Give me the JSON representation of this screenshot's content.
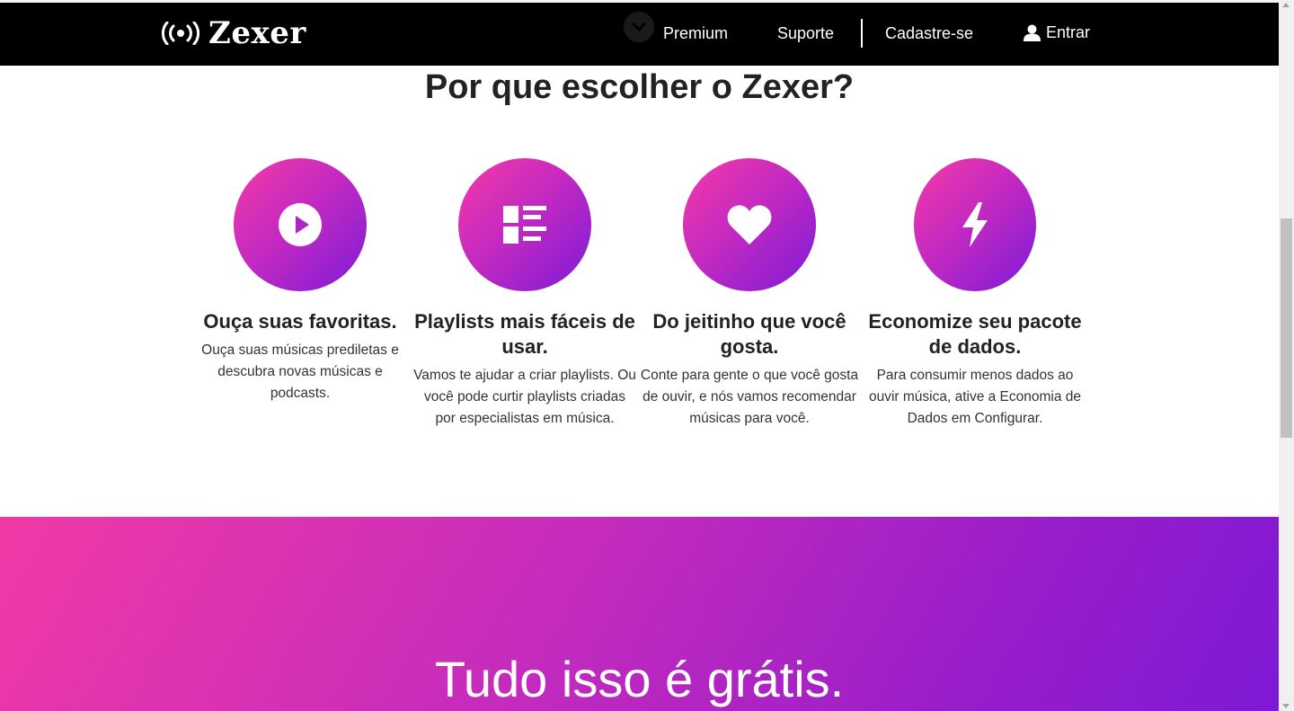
{
  "nav": {
    "brand": "Zexer",
    "logo_icon": "broadcast-icon",
    "links": {
      "premium": "Premium",
      "support": "Suporte",
      "signup": "Cadastre-se",
      "login": "Entrar"
    },
    "login_icon": "user-icon"
  },
  "section": {
    "heading": "Por que escolher o Zexer?"
  },
  "features": [
    {
      "icon": "play-icon",
      "title": "Ouça suas favoritas.",
      "desc": "Ouça suas músicas prediletas e descubra novas músicas e podcasts."
    },
    {
      "icon": "playlist-icon",
      "title": "Playlists mais fáceis de usar.",
      "desc": "Vamos te ajudar a criar playlists. Ou você pode curtir playlists criadas por especialistas em música."
    },
    {
      "icon": "heart-icon",
      "title": "Do jeitinho que você gosta.",
      "desc": "Conte para gente o que você gosta de ouvir, e nós vamos recomendar músicas para você."
    },
    {
      "icon": "lightning-icon",
      "title": "Economize seu pacote de dados.",
      "desc": "Para consumir menos dados ao ouvir música, ative a Economia de Dados em Configurar."
    }
  ],
  "banner": {
    "text": "Tudo isso é grátis."
  },
  "colors": {
    "gradient_start": "#f13aa6",
    "gradient_end": "#7e19d6",
    "navbar": "#000000"
  }
}
